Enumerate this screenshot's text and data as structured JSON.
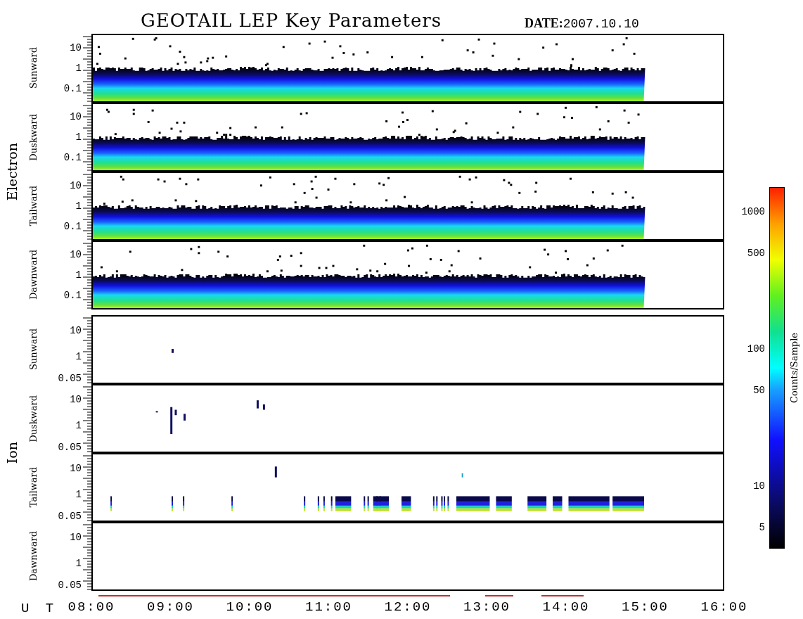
{
  "title": "GEOTAIL LEP Key Parameters",
  "date": {
    "label": "DATE:",
    "value": "2007.10.10"
  },
  "groups": [
    {
      "name": "Electron",
      "kind": "electron",
      "panels": [
        {
          "label": "Sunward",
          "yticks": [
            "10",
            "1",
            "0.1"
          ]
        },
        {
          "label": "Duskward",
          "yticks": [
            "10",
            "1",
            "0.1"
          ]
        },
        {
          "label": "Tailward",
          "yticks": [
            "10",
            "1",
            "0.1"
          ]
        },
        {
          "label": "Dawnward",
          "yticks": [
            "10",
            "1",
            "0.1"
          ]
        }
      ]
    },
    {
      "name": "Ion",
      "kind": "ion",
      "panels": [
        {
          "label": "Sunward",
          "yticks": [
            "10",
            "1",
            "0.05"
          ]
        },
        {
          "label": "Duskward",
          "yticks": [
            "10",
            "1",
            "0.05"
          ]
        },
        {
          "label": "Tailward",
          "yticks": [
            "10",
            "1",
            "0.05"
          ]
        },
        {
          "label": "Dawnward",
          "yticks": [
            "10",
            "1",
            "0.05"
          ]
        }
      ]
    }
  ],
  "time_axis": {
    "label": "U T",
    "ticks": [
      "08:00",
      "09:00",
      "10:00",
      "11:00",
      "12:00",
      "13:00",
      "14:00",
      "15:00",
      "16:00"
    ]
  },
  "colorbar": {
    "label": "Counts/Sample",
    "ticks": [
      "1000",
      "500",
      "100",
      "50",
      "10",
      "5"
    ]
  }
}
